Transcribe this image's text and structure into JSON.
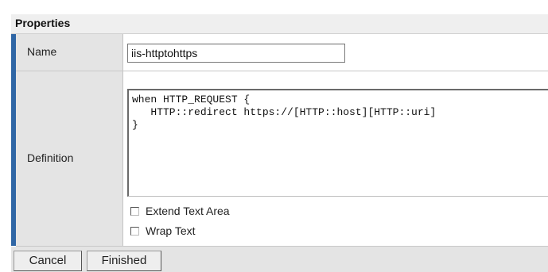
{
  "section": {
    "title": "Properties"
  },
  "fields": {
    "name_label": "Name",
    "name_value": "iis-httptohttps",
    "definition_label": "Definition",
    "definition_code": "when HTTP_REQUEST {\n   HTTP::redirect https://[HTTP::host][HTTP::uri]\n}"
  },
  "options": {
    "extend_text_area": "Extend Text Area",
    "wrap_text": "Wrap Text"
  },
  "buttons": {
    "cancel": "Cancel",
    "finished": "Finished"
  },
  "colors": {
    "accent": "#2f66a5"
  }
}
